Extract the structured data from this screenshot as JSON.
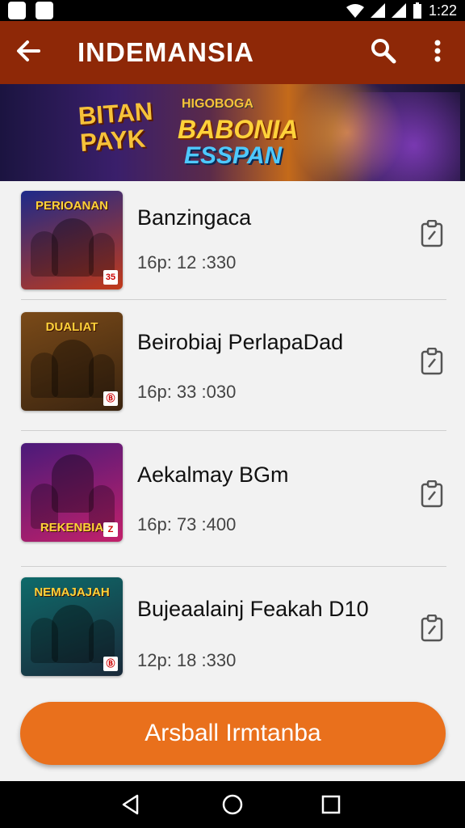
{
  "status_bar": {
    "time": "1:22"
  },
  "app_bar": {
    "title": "INDEMANSIA"
  },
  "banner": {
    "left_title": "BITAN PAYK",
    "small_title": "HIGOBOGA",
    "main_title": "BABONIA",
    "sub_title": "ESSPAN"
  },
  "items": [
    {
      "name": "Banzingaca",
      "time": "16p: 12 :330",
      "thumb_title": "PERIOANAN",
      "thumb_badge": "35",
      "color_a": "#1d2a8a",
      "color_b": "#c23a1a"
    },
    {
      "name": "Beirobiaj PerlapaDad",
      "time": "16p: 33 :030",
      "thumb_title": "DUALIAT",
      "thumb_badge": "Ⓑ",
      "color_a": "#7a4a18",
      "color_b": "#3a2410"
    },
    {
      "name": "Aekalmay BGm",
      "time": "16p: 73 :400",
      "thumb_title": "REKENBIA",
      "thumb_badge": "Z",
      "color_a": "#4a1a7a",
      "color_b": "#c2206a"
    },
    {
      "name": "Bujeaalainj Feakah D10",
      "time": "12p: 18 :330",
      "thumb_title": "NEMAJAJAH",
      "thumb_badge": "Ⓑ",
      "color_a": "#0e6a6a",
      "color_b": "#1a2a3a"
    }
  ],
  "fab": {
    "label": "Arsball Irmtanba"
  },
  "colors": {
    "app_bar": "#8e2807",
    "accent": "#e9701c"
  }
}
